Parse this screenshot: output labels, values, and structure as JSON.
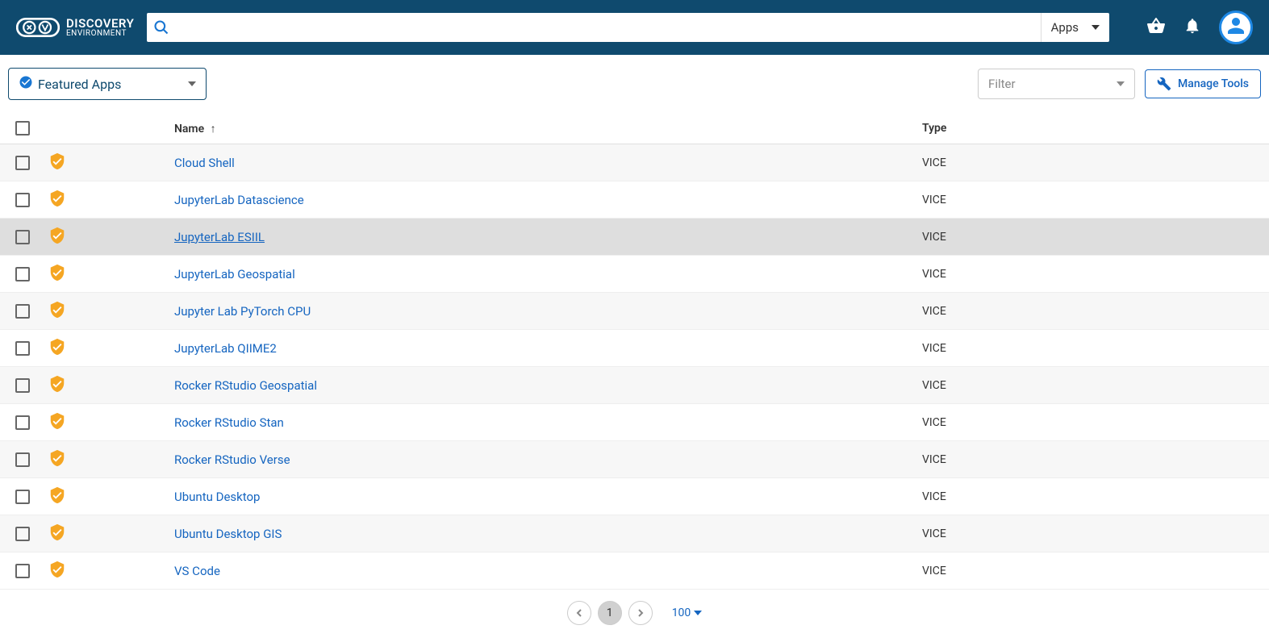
{
  "header": {
    "logo_top": "DISCOVERY",
    "logo_bottom": "ENVIRONMENT",
    "search_type": "Apps"
  },
  "toolbar": {
    "featured_label": "Featured Apps",
    "filter_placeholder": "Filter",
    "manage_label": "Manage Tools"
  },
  "columns": {
    "name": "Name",
    "type": "Type"
  },
  "apps": [
    {
      "name": "Cloud Shell",
      "type": "VICE",
      "hovered": false
    },
    {
      "name": "JupyterLab Datascience",
      "type": "VICE",
      "hovered": false
    },
    {
      "name": "JupyterLab ESIIL",
      "type": "VICE",
      "hovered": true
    },
    {
      "name": "JupyterLab Geospatial",
      "type": "VICE",
      "hovered": false
    },
    {
      "name": "Jupyter Lab PyTorch CPU",
      "type": "VICE",
      "hovered": false
    },
    {
      "name": "JupyterLab QIIME2",
      "type": "VICE",
      "hovered": false
    },
    {
      "name": "Rocker RStudio Geospatial",
      "type": "VICE",
      "hovered": false
    },
    {
      "name": "Rocker RStudio Stan",
      "type": "VICE",
      "hovered": false
    },
    {
      "name": "Rocker RStudio Verse",
      "type": "VICE",
      "hovered": false
    },
    {
      "name": "Ubuntu Desktop",
      "type": "VICE",
      "hovered": false
    },
    {
      "name": "Ubuntu Desktop GIS",
      "type": "VICE",
      "hovered": false
    },
    {
      "name": "VS Code",
      "type": "VICE",
      "hovered": false
    }
  ],
  "pagination": {
    "current_page": "1",
    "page_size": "100"
  }
}
